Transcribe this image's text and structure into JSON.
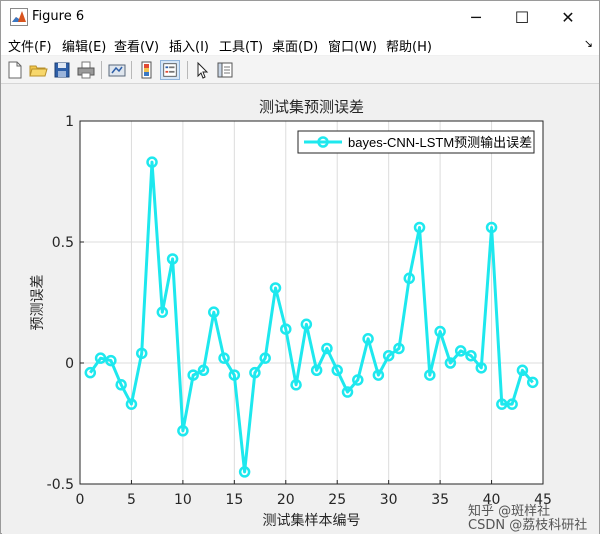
{
  "window": {
    "title": "Figure 6",
    "controls": {
      "minimize": "─",
      "maximize": "☐",
      "close": "✕"
    }
  },
  "menu": {
    "items": [
      "文件(F)",
      "编辑(E)",
      "查看(V)",
      "插入(I)",
      "工具(T)",
      "桌面(D)",
      "窗口(W)",
      "帮助(H)"
    ],
    "overflow_arrow": "↘"
  },
  "toolbar": {
    "icons": [
      "new-figure-icon",
      "open-file-icon",
      "save-icon",
      "print-icon",
      "link-plot-icon",
      "colorbar-icon",
      "legend-icon",
      "pointer-icon",
      "property-editor-icon"
    ]
  },
  "colors": {
    "series": "#1ee8ee",
    "axes_bg": "#ffffff",
    "figure_bg": "#f0f0f0",
    "grid": "#dcdcdc"
  },
  "chart_data": {
    "type": "line",
    "title": "测试集预测误差",
    "xlabel": "测试集样本编号",
    "ylabel": "预测误差",
    "xlim": [
      0,
      45
    ],
    "ylim": [
      -0.5,
      1
    ],
    "xticks": [
      0,
      5,
      10,
      15,
      20,
      25,
      30,
      35,
      40,
      45
    ],
    "yticks": [
      -0.5,
      0,
      0.5,
      1
    ],
    "ytick_labels": [
      "-0.5",
      "0",
      "0.5",
      "1"
    ],
    "grid": true,
    "legend_location": "top-right",
    "series": [
      {
        "name": "bayes-CNN-LSTM预测输出误差",
        "marker": "circle",
        "x": [
          1,
          2,
          3,
          4,
          5,
          6,
          7,
          8,
          9,
          10,
          11,
          12,
          13,
          14,
          15,
          16,
          17,
          18,
          19,
          20,
          21,
          22,
          23,
          24,
          25,
          26,
          27,
          28,
          29,
          30,
          31,
          32,
          33,
          34,
          35,
          36,
          37,
          38,
          39,
          40,
          41,
          42,
          43,
          44
        ],
        "y": [
          -0.04,
          0.02,
          0.01,
          -0.09,
          -0.17,
          0.04,
          0.83,
          0.21,
          0.43,
          -0.28,
          -0.05,
          -0.03,
          0.21,
          0.02,
          -0.05,
          -0.45,
          -0.04,
          0.02,
          0.31,
          0.14,
          -0.09,
          0.16,
          -0.03,
          0.06,
          -0.03,
          -0.12,
          -0.07,
          0.1,
          -0.05,
          0.03,
          0.06,
          0.35,
          0.56,
          -0.05,
          0.13,
          0.0,
          0.05,
          0.03,
          -0.02,
          0.56,
          -0.17,
          -0.17,
          -0.03,
          -0.08
        ]
      }
    ]
  },
  "watermark": {
    "line1": "知乎 @斑样社",
    "line2": "CSDN @荔枝科研社"
  }
}
